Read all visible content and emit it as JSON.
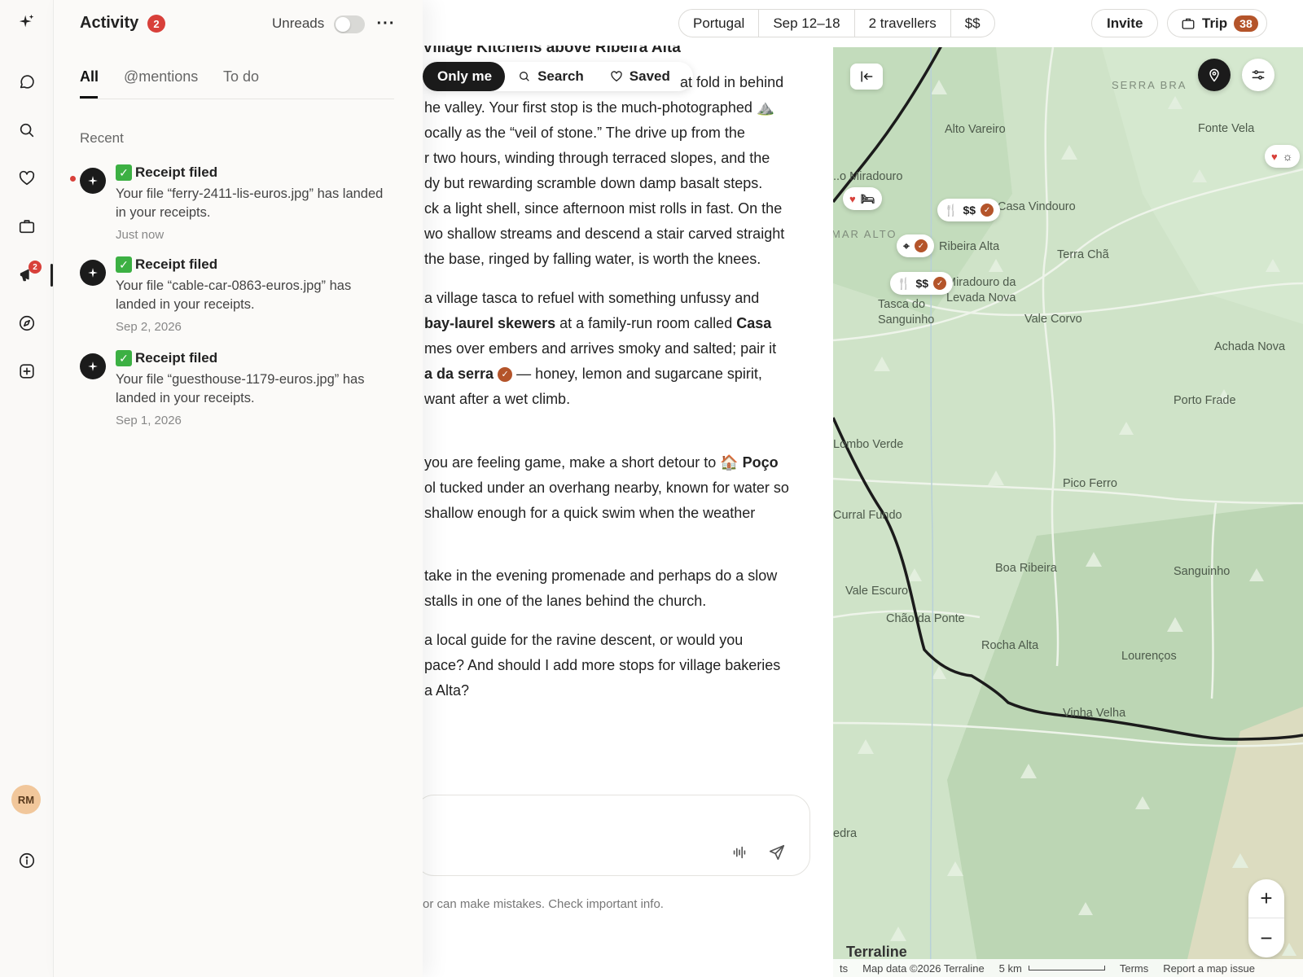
{
  "rail": {
    "items": [
      "logo",
      "chat",
      "search",
      "saved",
      "trips",
      "activity",
      "explore",
      "new"
    ],
    "activity_badge": "2",
    "avatar_initials": "RM"
  },
  "activity": {
    "title": "Activity",
    "count": "2",
    "unreads_label": "Unreads",
    "unreads_on": false,
    "tabs": [
      {
        "label": "All",
        "active": true
      },
      {
        "label": "@mentions",
        "active": false
      },
      {
        "label": "To do",
        "active": false
      }
    ],
    "section_label": "Recent",
    "items": [
      {
        "title": "Receipt filed",
        "body": "Your file “ferry-2411-lis-euros.jpg” has landed in your receipts.",
        "time": "Just now",
        "unread": true
      },
      {
        "title": "Receipt filed",
        "body": "Your file “cable-car-0863-euros.jpg” has landed in your receipts.",
        "time": "Sep 2, 2026",
        "unread": false
      },
      {
        "title": "Receipt filed",
        "body": "Your file “guesthouse-1179-euros.jpg” has landed in your receipts.",
        "time": "Sep 1, 2026",
        "unread": false
      }
    ]
  },
  "topbar": {
    "chips": [
      "Portugal",
      "Sep 12–18",
      "2 travellers",
      "$$"
    ],
    "invite_label": "Invite",
    "trip_label": "Trip",
    "trip_count": "38"
  },
  "chat": {
    "title": "Village Kitchens above Ribeira Alta",
    "filters": [
      "Only me",
      "Search",
      "Saved"
    ],
    "lines": [
      "at fold in behind",
      "he valley. Your first stop is the much-photographed ⛰️",
      "ocally as the “veil of stone.” The drive up from the",
      "r two hours, winding through terraced slopes, and the",
      "dy but rewarding scramble down damp basalt steps.",
      "ck a light shell, since afternoon mist rolls in fast. On the",
      "wo shallow streams and descend a stair carved straight",
      "the base, ringed by falling water, is worth the knees.",
      "a village tasca to refuel with something unfussy and",
      "at a family-run room called",
      "mes over embers and arrives smoky and salted; pair it",
      "— honey, lemon and sugarcane spirit,",
      "want after a wet climb.",
      "you are feeling game, make a short detour to 🏠",
      "ol tucked under an overhang nearby, known for water so",
      "shallow enough for a quick swim when the weather",
      "take in the evening promenade and perhaps do a slow",
      "stalls in one of the lanes behind the church.",
      "a local guide for the ravine descent, or would you",
      "pace? And should I add more stops for village bakeries",
      "a Alta?"
    ],
    "bold_skewers": "bay-laurel skewers",
    "bold_casa": "Casa",
    "bold_poncha": "a da serra",
    "bold_poco": "Poço",
    "composer_placeholder": "",
    "disclaimer": "or can make mistakes. Check important info."
  },
  "map": {
    "region_labels": [
      "SERRA BRA",
      "MAR ALTO"
    ],
    "places": [
      "Alto Vareiro",
      "Fonte Vela",
      "..o Miradouro",
      "Casa Vindouro",
      "Ribeira Alta",
      "Terra Chã",
      "Miradouro da Levada Nova",
      "Tasca do Sanguinho",
      "Vale Corvo",
      "Achada Nova",
      "Porto Frade",
      "Lombo Verde",
      "Pico Ferro",
      "Curral Fundo",
      "Boa Ribeira",
      "Sanguinho",
      "Vale Escuro",
      "Chão da Ponte",
      "Rocha Alta",
      "Lourenços",
      "Vinha Velha",
      "edra"
    ],
    "marker_price": "$$",
    "attribution": {
      "left": "ts",
      "data": "Map data ©2026 Terraline",
      "scale": "5 km",
      "terms": "Terms",
      "report": "Report a map issue"
    },
    "logo": "Terraline",
    "zoom_in": "+",
    "zoom_out": "−"
  }
}
